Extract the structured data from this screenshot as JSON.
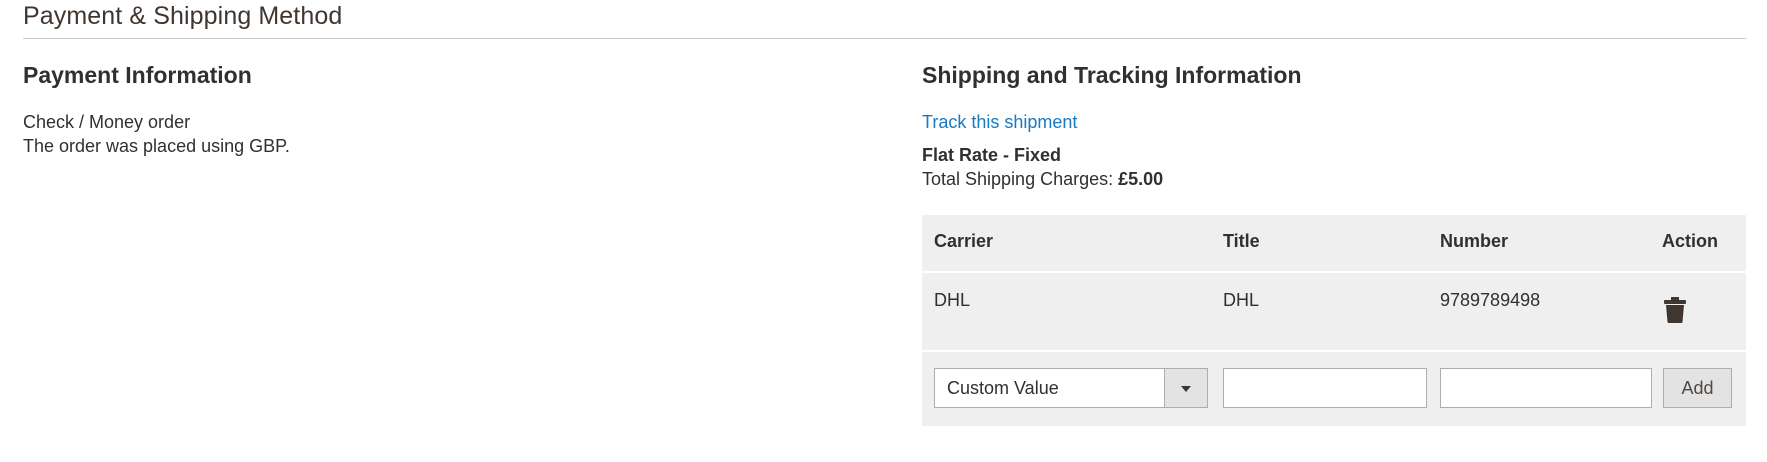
{
  "section": {
    "title": "Payment & Shipping Method"
  },
  "payment": {
    "title": "Payment Information",
    "method": "Check / Money order",
    "currency_note": "The order was placed using GBP."
  },
  "shipping": {
    "title": "Shipping and Tracking Information",
    "track_link": "Track this shipment",
    "method_name": "Flat Rate - Fixed",
    "charges_label": "Total Shipping Charges: ",
    "charges_value": "£5.00"
  },
  "tracking_table": {
    "headers": {
      "carrier": "Carrier",
      "title": "Title",
      "number": "Number",
      "action": "Action"
    },
    "rows": [
      {
        "carrier": "DHL",
        "title": "DHL",
        "number": "9789789498",
        "action_icon": "trash-icon"
      }
    ],
    "new_row": {
      "carrier_selected": "Custom Value",
      "title_value": "",
      "number_value": "",
      "add_label": "Add"
    }
  },
  "colors": {
    "link": "#1979c3",
    "table_bg": "#efefef",
    "text": "#303030",
    "button_bg": "#e3e3e3"
  }
}
